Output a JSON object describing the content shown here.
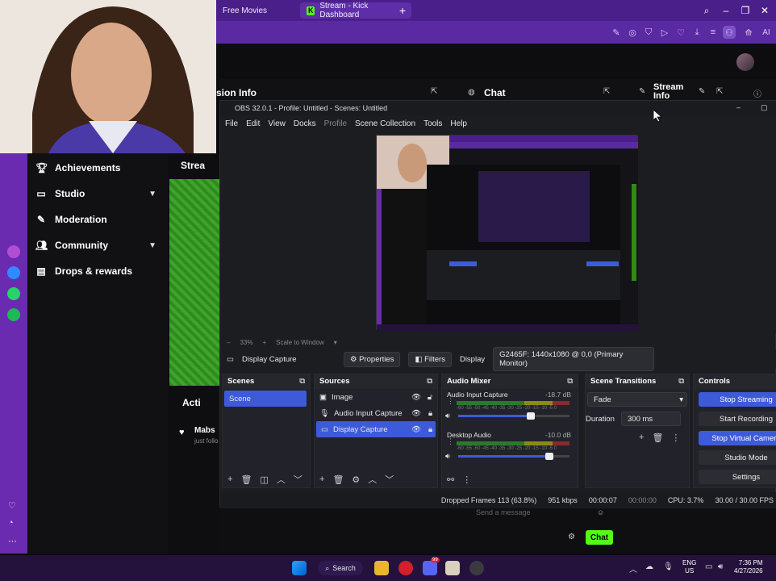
{
  "browser": {
    "tabs": [
      {
        "label": "Free Movies"
      },
      {
        "label": "Stream - Kick Dashboard",
        "favicon": "K"
      }
    ],
    "new_tab": "+",
    "ai_label": "AI"
  },
  "kick": {
    "panels": {
      "session": "sion Info",
      "chat": "Chat",
      "stream": "Stream Info"
    },
    "stream_preview_label": "Strea",
    "activity_label": "Acti",
    "activity_user": "Mabs",
    "activity_sub": "just follo",
    "nav": [
      {
        "label": "Achievements",
        "icon": "trophy-icon"
      },
      {
        "label": "Studio",
        "icon": "monitor-icon",
        "chevron": true
      },
      {
        "label": "Moderation",
        "icon": "wrench-icon"
      },
      {
        "label": "Community",
        "icon": "people-icon",
        "chevron": true
      },
      {
        "label": "Drops & rewards",
        "icon": "gift-icon"
      }
    ],
    "chat_placeholder": "Send a message",
    "chat_button": "Chat"
  },
  "obs": {
    "title": "OBS 32.0.1 - Profile: Untitled - Scenes: Untitled",
    "menu": [
      "File",
      "Edit",
      "View",
      "Docks",
      "Profile",
      "Scene Collection",
      "Tools",
      "Help"
    ],
    "zoom": "33%",
    "scale_mode": "Scale to Window",
    "source_selected": "Display Capture",
    "properties_btn": "Properties",
    "filters_btn": "Filters",
    "display_label": "Display",
    "display_value": "G2465F: 1440x1080 @ 0,0 (Primary Monitor)",
    "docks": {
      "scenes": {
        "title": "Scenes",
        "items": [
          "Scene"
        ]
      },
      "sources": {
        "title": "Sources",
        "items": [
          "Image",
          "Audio Input Capture",
          "Display Capture"
        ]
      },
      "mixer": {
        "title": "Audio Mixer",
        "channels": [
          {
            "name": "Audio Input Capture",
            "db": "-18.7 dB",
            "level": 0.65
          },
          {
            "name": "Desktop Audio",
            "db": "-10.0 dB",
            "level": 0.82
          }
        ],
        "scale": "-60 -55 -50 -45 -40 -35 -30 -25 -20 -15 -10 -5 0"
      },
      "transitions": {
        "title": "Scene Transitions",
        "type": "Fade",
        "duration_label": "Duration",
        "duration_value": "300 ms"
      },
      "controls": {
        "title": "Controls",
        "buttons": [
          "Stop Streaming",
          "Start Recording",
          "Stop Virtual Camera",
          "Studio Mode",
          "Settings"
        ]
      }
    },
    "status": {
      "dropped": "Dropped Frames 113 (63.8%)",
      "kbps": "951 kbps",
      "stream_time": "00:00:07",
      "rec_time": "00:00:00",
      "cpu": "CPU: 3.7%",
      "fps": "30.00 / 30.00 FPS"
    }
  },
  "taskbar": {
    "search": "Search",
    "lang": "ENG",
    "region": "US",
    "time": "7:36 PM",
    "date": "4/27/2026",
    "badge": "99"
  },
  "colors": {
    "kick_green": "#53fc18",
    "purple": "#5a2aa3",
    "obs_blue": "#3d5bd9"
  }
}
